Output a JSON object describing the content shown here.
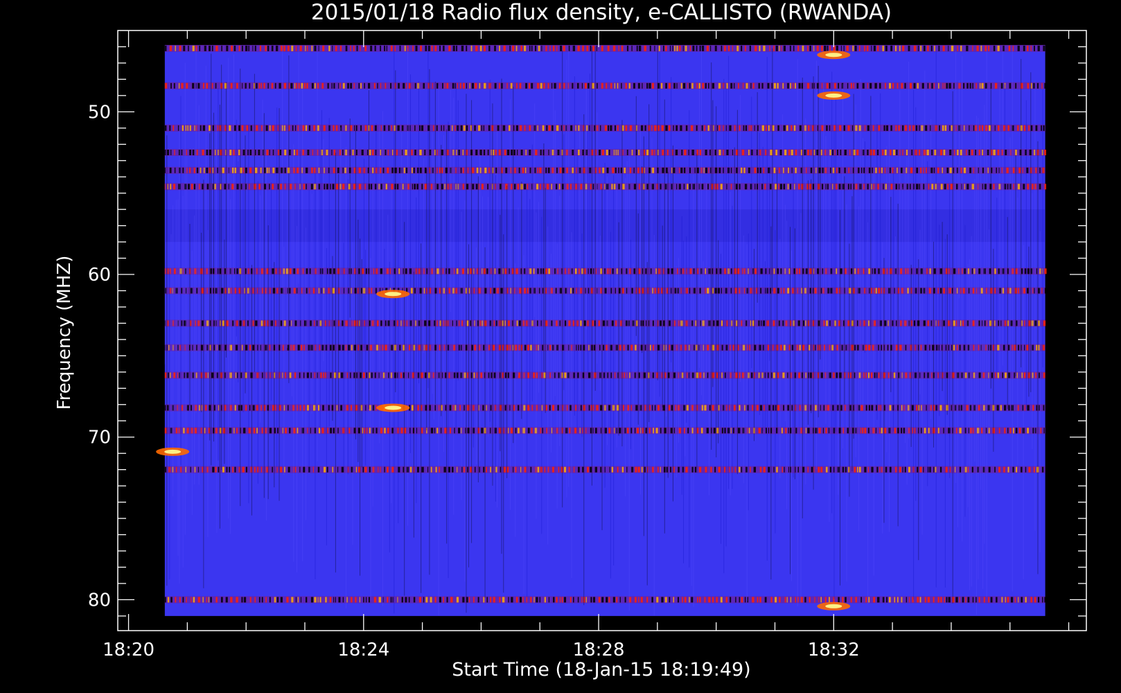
{
  "chart_data": {
    "type": "heatmap",
    "title": "2015/01/18  Radio flux density, e-CALLISTO (RWANDA)",
    "xlabel": "Start Time (18-Jan-15 18:19:49)",
    "ylabel": "Frequency (MHZ)",
    "x_range": [
      "18:19:49",
      "18:36:18"
    ],
    "y_range": [
      45,
      81.9
    ],
    "y_inverted": true,
    "x_ticks": [
      "18:20",
      "18:24",
      "18:28",
      "18:32"
    ],
    "y_ticks": [
      50,
      60,
      70,
      80
    ],
    "data_extent_x": [
      "18:20:37",
      "18:35:36"
    ],
    "data_extent_y": [
      45.9,
      81.0
    ],
    "colormap": [
      "#000000",
      "#1a1aff",
      "#ff0000",
      "#ffb000",
      "#ffff80"
    ],
    "background_color": "#3b36f0",
    "bright_bands_mhz": [
      46.1,
      48.4,
      51.0,
      52.5,
      53.6,
      54.6,
      59.8,
      61.0,
      63.0,
      64.5,
      66.2,
      68.2,
      69.6,
      72.0,
      80.0
    ],
    "dark_band_mhz": [
      56.0,
      58.0
    ],
    "bursts": [
      {
        "time": "18:32",
        "freq_mhz": 46.5
      },
      {
        "time": "18:32",
        "freq_mhz": 49.0
      },
      {
        "time": "18:32",
        "freq_mhz": 80.4
      },
      {
        "time": "18:24:30",
        "freq_mhz": 61.2
      },
      {
        "time": "18:24:30",
        "freq_mhz": 68.2
      },
      {
        "time": "18:20:45",
        "freq_mhz": 70.9
      }
    ]
  }
}
